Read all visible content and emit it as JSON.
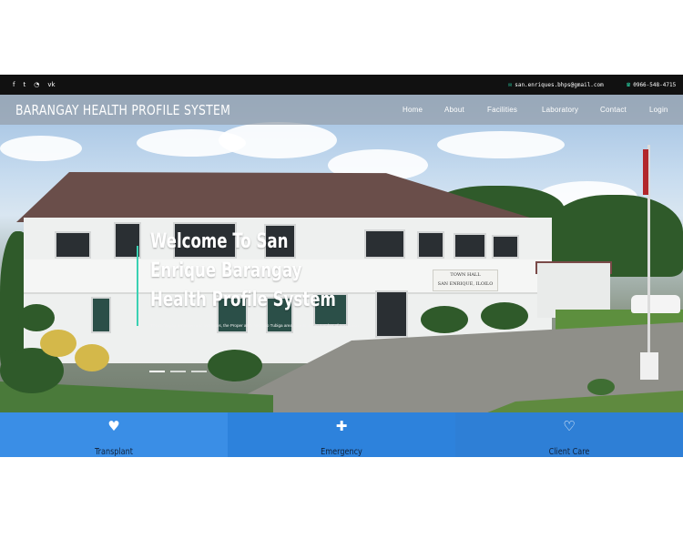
{
  "topbar": {
    "social": [
      {
        "icon": "facebook-icon",
        "glyph": "f"
      },
      {
        "icon": "twitter-icon",
        "glyph": "t"
      },
      {
        "icon": "rss-icon",
        "glyph": "◔"
      },
      {
        "icon": "vk-icon",
        "glyph": "vk"
      }
    ],
    "email_icon": "✉",
    "email": "san.enriques.bhps@gmail.com",
    "phone_icon": "☎",
    "phone": "0966-548-4715"
  },
  "navbar": {
    "brand": "BARANGAY HEALTH PROFILE SYSTEM",
    "links": [
      "Home",
      "About",
      "Facilities",
      "Laboratory",
      "Contact",
      "Login"
    ]
  },
  "hero": {
    "title": "Welcome To San Enrique Barangay Health Profile System",
    "description": "The barangay is divided into two sitios, the Proper area and sitio Tubiga area, due to its big number of population.",
    "sign_line1": "TOWN HALL",
    "sign_line2": "SAN ENRIQUE, ILOILO",
    "slides": 3,
    "active_slide": 1
  },
  "features": [
    {
      "label": "Transplant",
      "icon": "heart-icon",
      "glyph": "♥"
    },
    {
      "label": "Emergency",
      "icon": "ambulance-icon",
      "glyph": "✚"
    },
    {
      "label": "Client Care",
      "icon": "heartbeat-icon",
      "glyph": "♡"
    }
  ],
  "colors": {
    "topbar": "#111111",
    "accent": "#3ad1b3",
    "feature_blue": "#3a8ee6"
  }
}
